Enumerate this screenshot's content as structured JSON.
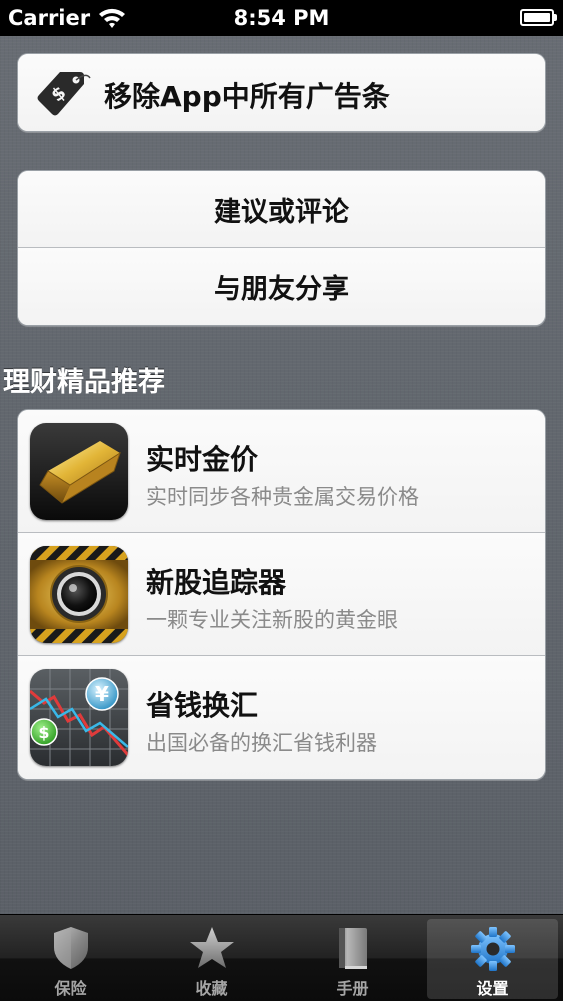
{
  "status_bar": {
    "carrier": "Carrier",
    "time": "8:54 PM"
  },
  "remove_ads": {
    "label": "移除App中所有广告条",
    "icon": "price-tag-icon"
  },
  "actions": {
    "feedback_label": "建议或评论",
    "share_label": "与朋友分享"
  },
  "recommend": {
    "section_title": "理财精品推荐",
    "apps": [
      {
        "name": "实时金价",
        "desc": "实时同步各种贵金属交易价格",
        "icon": "gold-bar-icon"
      },
      {
        "name": "新股追踪器",
        "desc": "一颗专业关注新股的黄金眼",
        "icon": "camera-lens-icon"
      },
      {
        "name": "省钱换汇",
        "desc": "出国必备的换汇省钱利器",
        "icon": "currency-exchange-icon"
      }
    ]
  },
  "tab_bar": {
    "selected_index": 3,
    "accent": "#2f8fe0",
    "tabs": [
      {
        "label": "保险",
        "icon": "shield-icon"
      },
      {
        "label": "收藏",
        "icon": "star-icon"
      },
      {
        "label": "手册",
        "icon": "book-icon"
      },
      {
        "label": "设置",
        "icon": "gear-icon"
      }
    ]
  }
}
